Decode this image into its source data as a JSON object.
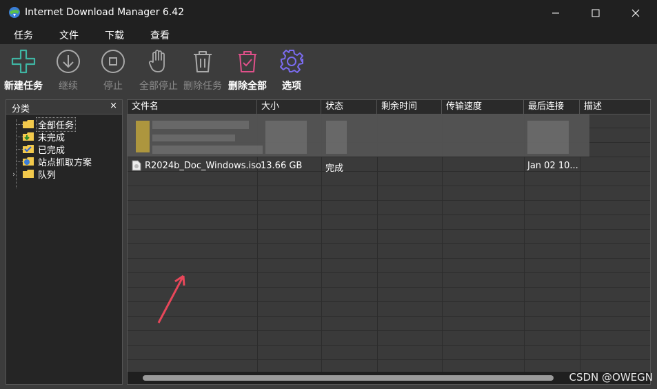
{
  "window": {
    "title": "Internet Download Manager 6.42"
  },
  "menu": [
    "任务",
    "文件",
    "下载",
    "查看"
  ],
  "toolbar": [
    {
      "label": "新建任务",
      "icon": "plus-icon",
      "enabled": true
    },
    {
      "label": "继续",
      "icon": "download-arrow-icon",
      "enabled": false
    },
    {
      "label": "停止",
      "icon": "stop-icon",
      "enabled": false
    },
    {
      "label": "全部停止",
      "icon": "hand-stop-icon",
      "enabled": false
    },
    {
      "label": "删除任务",
      "icon": "trash-icon",
      "enabled": false
    },
    {
      "label": "删除全部",
      "icon": "trash-check-icon",
      "enabled": true
    },
    {
      "label": "选项",
      "icon": "gear-icon",
      "enabled": true
    }
  ],
  "categories": {
    "title": "分类",
    "close": "×",
    "items": [
      "全部任务",
      "未完成",
      "已完成",
      "站点抓取方案",
      "队列"
    ],
    "selected": "全部任务"
  },
  "list": {
    "columns": [
      "文件名",
      "大小",
      "状态",
      "剩余时间",
      "传输速度",
      "最后连接",
      "描述"
    ],
    "rows": [
      {
        "name": "R2024b_Doc_Windows.iso",
        "size": "13.66  GB",
        "status": "完成",
        "remaining": "",
        "speed": "",
        "last": "Jan 02 10...",
        "desc": ""
      }
    ]
  },
  "watermark": "CSDN @OWEGN",
  "colors": {
    "accent_green": "#3fb5a3",
    "accent_pink": "#e0508a",
    "accent_purple": "#7b6cf0"
  }
}
